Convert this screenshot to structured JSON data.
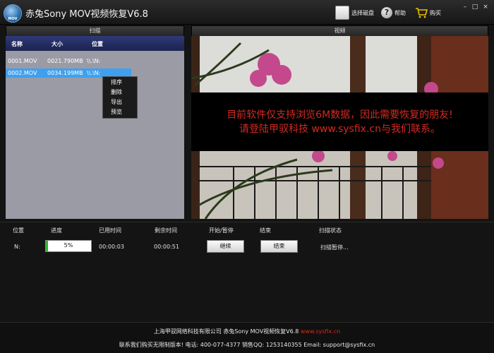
{
  "app": {
    "logo_text": "MOV",
    "title": "赤兔Sony MOV视频恢复V6.8"
  },
  "toolbar": {
    "select_disk_label": "选择磁盘",
    "help_icon_glyph": "?",
    "help_label": "帮助",
    "buy_label": "购买"
  },
  "window_controls": [
    "–",
    "□",
    "×"
  ],
  "scan_panel": {
    "title": "扫描",
    "columns": [
      "名称",
      "大小",
      "位置"
    ],
    "rows": [
      {
        "name": "0001.MOV",
        "size": "0021.790MB",
        "location": "\\\\.\\N:"
      },
      {
        "name": "0002.MOV",
        "size": "0034.199MB",
        "location": "\\\\.\\N:",
        "selected": true
      }
    ],
    "context_menu": [
      "排序",
      "删除",
      "导出",
      "预览"
    ]
  },
  "video_panel": {
    "title": "视频",
    "notice_line1": "目前软件仅支持浏览6M数据，因此需要恢复的朋友!",
    "notice_line2": "请登陆甲驭科技 www.sysfix.cn与我们联系。"
  },
  "progress": {
    "headers": [
      "位置",
      "进度",
      "已用时间",
      "剩余时间",
      "开始/暂停",
      "结束",
      "扫描状态"
    ],
    "location": "N:",
    "percent_text": "5%",
    "fraction": 0.05,
    "elapsed": "00:00:03",
    "remaining": "00:00:51",
    "continue_label": "继续",
    "stop_label": "结束",
    "status": "扫描暂停..."
  },
  "footer": {
    "line1_text": "上海甲驭网络科技有限公司 赤兔Sony MOV视频恢复V6.8 ",
    "line1_url": "www.sysfix.cn",
    "line2_text": "联系我们购买无限制版本! 电话: 400-077-4377 销售QQ: 1253140355 Email: support@sysfix.cn"
  },
  "colors": {
    "notice_red": "#d42a22",
    "selection_blue": "#3ea0ef",
    "header_blue": "#2e3a78",
    "progress_green": "#2fb52f"
  }
}
